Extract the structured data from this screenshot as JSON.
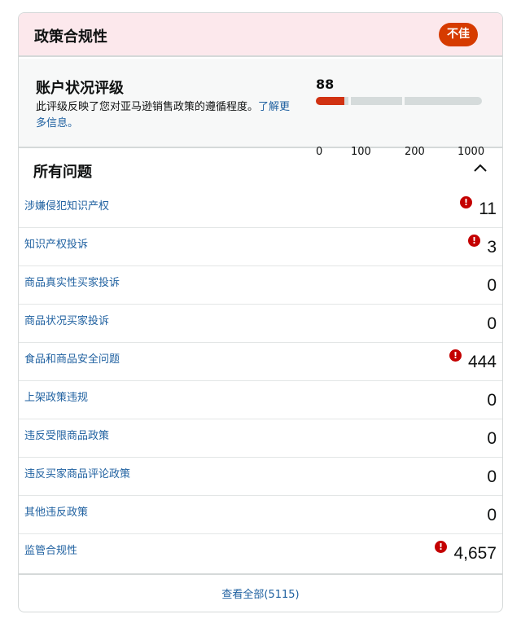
{
  "header": {
    "title": "政策合规性",
    "status": "不佳"
  },
  "rating": {
    "title": "账户状况评级",
    "description": "此评级反映了您对亚马逊销售政策的遵循程度。",
    "learn_more": "了解更多信息。",
    "score": "88",
    "fill_fraction_of_first_segment": 0.88,
    "ticks": [
      "0",
      "100",
      "200",
      "1000"
    ]
  },
  "issues": {
    "title": "所有问题",
    "toggle_icon": "chevron-up-icon",
    "items": [
      {
        "label": "涉嫌侵犯知识产权",
        "count": "11",
        "alert": true
      },
      {
        "label": "知识产权投诉",
        "count": "3",
        "alert": true
      },
      {
        "label": "商品真实性买家投诉",
        "count": "0",
        "alert": false
      },
      {
        "label": "商品状况买家投诉",
        "count": "0",
        "alert": false
      },
      {
        "label": "食品和商品安全问题",
        "count": "444",
        "alert": true
      },
      {
        "label": "上架政策违规",
        "count": "0",
        "alert": false
      },
      {
        "label": "违反受限商品政策",
        "count": "0",
        "alert": false
      },
      {
        "label": "违反买家商品评论政策",
        "count": "0",
        "alert": false
      },
      {
        "label": "其他违反政策",
        "count": "0",
        "alert": false
      },
      {
        "label": "监管合规性",
        "count": "4,657",
        "alert": true
      }
    ]
  },
  "footer": {
    "view_all": "查看全部(5115)"
  },
  "colors": {
    "header_bg": "#fce8ec",
    "badge": "#d63b00",
    "link": "#2162a1",
    "alert": "#c40000",
    "meter_fill": "#d13212"
  }
}
